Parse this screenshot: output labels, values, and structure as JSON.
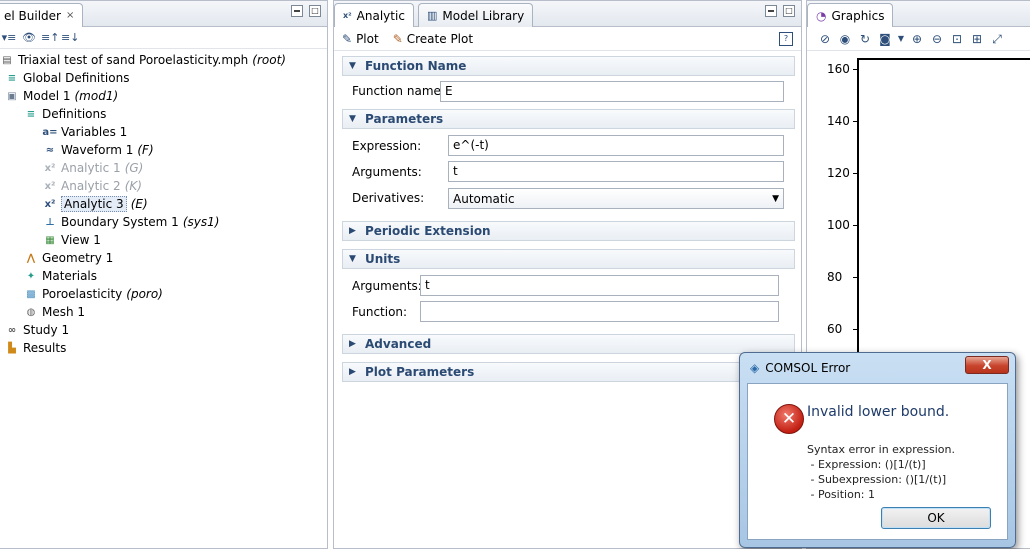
{
  "model_builder": {
    "tab_label": "el Builder",
    "tree": [
      {
        "label": "Triaxial test of sand Poroelasticity.mph",
        "tag": "(root)",
        "level": 0,
        "icon": "file-icon"
      },
      {
        "label": "Global Definitions",
        "tag": "",
        "level": 1,
        "icon": "list-icon"
      },
      {
        "label": "Model 1",
        "tag": "(mod1)",
        "level": 1,
        "icon": "model-icon"
      },
      {
        "label": "Definitions",
        "tag": "",
        "level": 2,
        "icon": "list-icon"
      },
      {
        "label": "Variables 1",
        "tag": "",
        "level": 3,
        "icon": "variables-icon",
        "icon_text": "a="
      },
      {
        "label": "Waveform 1",
        "tag": "(F)",
        "level": 3,
        "icon": "waveform-icon"
      },
      {
        "label": "Analytic 1",
        "tag": "(G)",
        "level": 3,
        "icon": "analytic-icon",
        "dim": true
      },
      {
        "label": "Analytic 2",
        "tag": "(K)",
        "level": 3,
        "icon": "analytic-icon",
        "dim": true
      },
      {
        "label": "Analytic 3",
        "tag": "(E)",
        "level": 3,
        "icon": "analytic-icon",
        "selected": true
      },
      {
        "label": "Boundary System 1",
        "tag": "(sys1)",
        "level": 3,
        "icon": "boundary-system-icon"
      },
      {
        "label": "View 1",
        "tag": "",
        "level": 3,
        "icon": "view-icon"
      },
      {
        "label": "Geometry 1",
        "tag": "",
        "level": 2,
        "icon": "geometry-icon"
      },
      {
        "label": "Materials",
        "tag": "",
        "level": 2,
        "icon": "materials-icon"
      },
      {
        "label": "Poroelasticity",
        "tag": "(poro)",
        "level": 2,
        "icon": "physics-icon"
      },
      {
        "label": "Mesh 1",
        "tag": "",
        "level": 2,
        "icon": "mesh-icon"
      },
      {
        "label": "Study 1",
        "tag": "",
        "level": 1,
        "icon": "study-icon"
      },
      {
        "label": "Results",
        "tag": "",
        "level": 1,
        "icon": "results-icon"
      }
    ]
  },
  "analytic": {
    "tab_label": "Analytic",
    "other_tab_label": "Model Library",
    "toolbar": {
      "plot_label": "Plot",
      "create_plot_label": "Create Plot"
    },
    "sections": {
      "function_name": "Function Name",
      "parameters": "Parameters",
      "periodic_extension": "Periodic Extension",
      "units": "Units",
      "advanced": "Advanced",
      "plot_parameters": "Plot Parameters"
    },
    "function_name_label": "Function name:",
    "function_name_value": "E",
    "expression_label": "Expression:",
    "expression_value": "e^(-t)",
    "arguments_label": "Arguments:",
    "arguments_value": "t",
    "derivatives_label": "Derivatives:",
    "derivatives_value": "Automatic",
    "units_arguments_label": "Arguments:",
    "units_arguments_value": "t",
    "units_function_label": "Function:",
    "units_function_value": ""
  },
  "graphics": {
    "tab_label": "Graphics",
    "y_ticks": [
      "160",
      "140",
      "120",
      "100",
      "80",
      "60"
    ]
  },
  "error_dialog": {
    "title": "COMSOL Error",
    "heading": "Invalid lower bound.",
    "message": "Syntax error in expression.",
    "details": [
      " - Expression: ()[1/(t)]",
      " - Subexpression: ()[1/(t)]",
      " - Position: 1"
    ],
    "ok_label": "OK",
    "close_label": "X"
  },
  "colors": {
    "accent": "#2b4a73",
    "selection": "#e4ecf7",
    "error_red": "#c21f12"
  }
}
